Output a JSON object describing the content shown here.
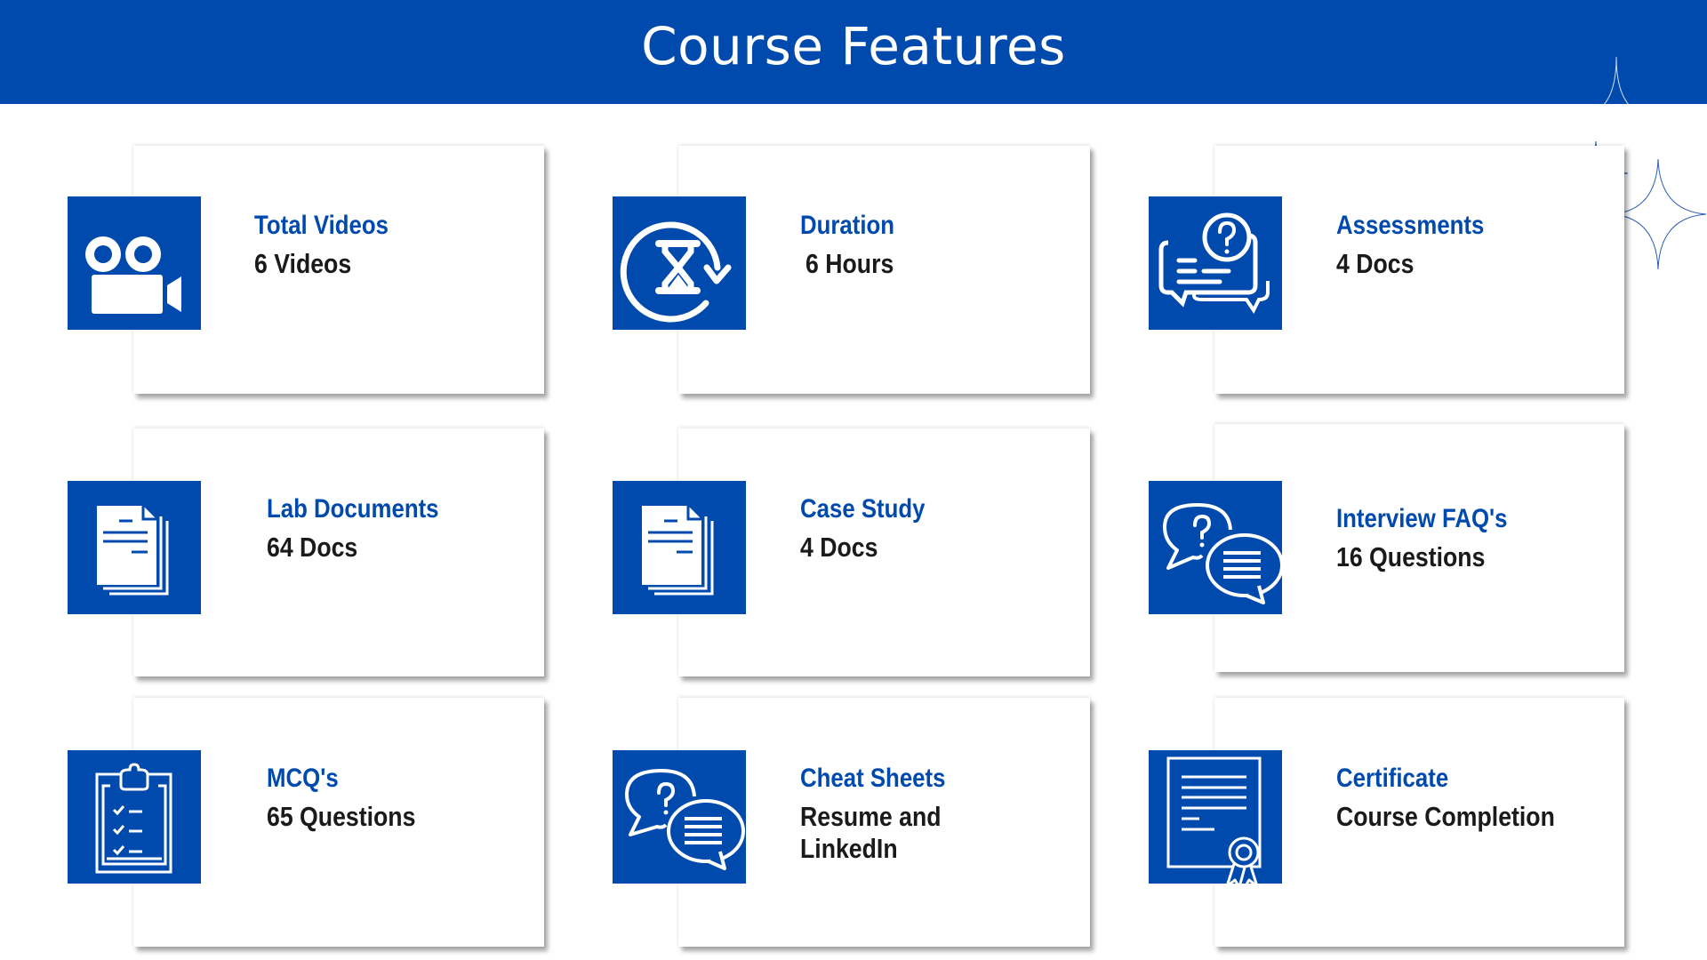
{
  "header": {
    "title": "Course Features"
  },
  "colors": {
    "brand_blue": "#004AAD",
    "value_text": "#1a1a1a",
    "background": "#ffffff"
  },
  "features": [
    {
      "icon": "video-camera-icon",
      "label": "Total Videos",
      "value": "6 Videos"
    },
    {
      "icon": "hourglass-refresh-icon",
      "label": "Duration",
      "value": "6 Hours"
    },
    {
      "icon": "question-chat-icon",
      "label": "Assessments",
      "value": "4 Docs"
    },
    {
      "icon": "documents-icon",
      "label": "Lab Documents",
      "value": "64 Docs"
    },
    {
      "icon": "documents-icon",
      "label": "Case Study",
      "value": "4 Docs"
    },
    {
      "icon": "faq-chat-icon",
      "label": "Interview FAQ's",
      "value": "16 Questions"
    },
    {
      "icon": "clipboard-checklist-icon",
      "label": "MCQ's",
      "value": "65 Questions"
    },
    {
      "icon": "faq-chat-icon",
      "label": "Cheat Sheets",
      "value": "Resume and LinkedIn"
    },
    {
      "icon": "certificate-icon",
      "label": "Certificate",
      "value": "Course Completion"
    }
  ]
}
